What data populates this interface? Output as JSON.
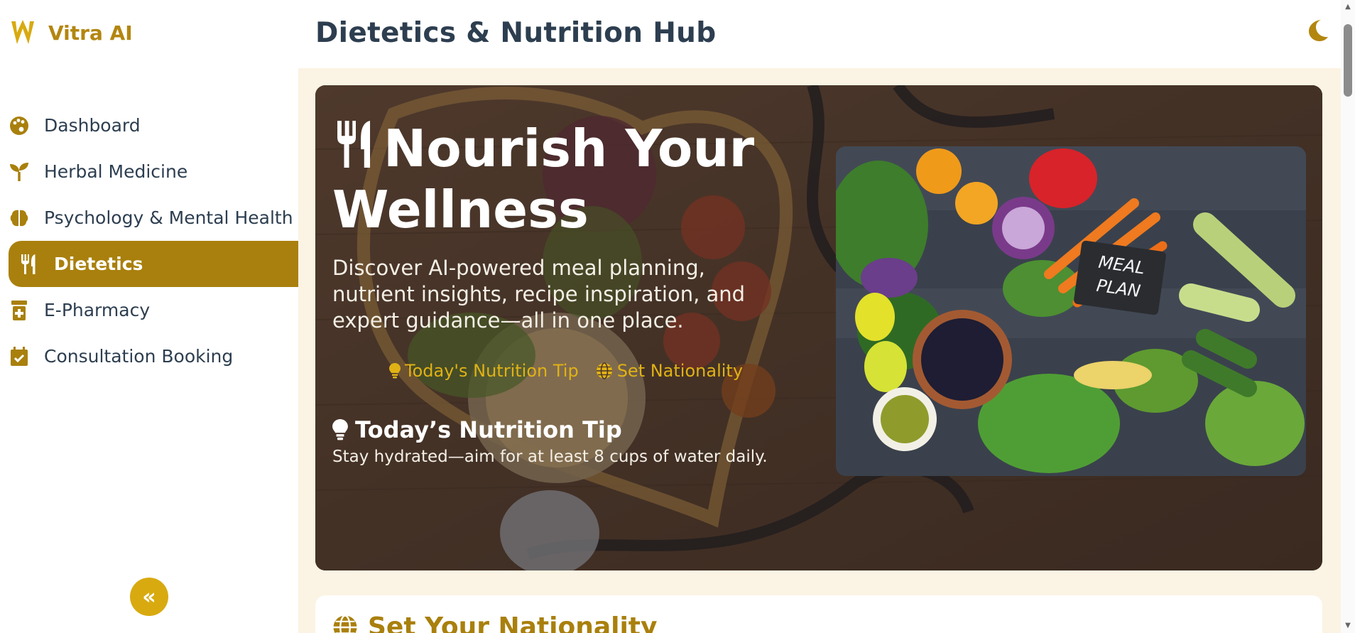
{
  "brand": {
    "name": "Vitra AI"
  },
  "sidebar": {
    "items": [
      {
        "label": "Dashboard",
        "icon": "palette-icon",
        "active": false
      },
      {
        "label": "Herbal Medicine",
        "icon": "seedling-icon",
        "active": false
      },
      {
        "label": "Psychology & Mental Health",
        "icon": "brain-icon",
        "active": false
      },
      {
        "label": "Dietetics",
        "icon": "utensils-icon",
        "active": true
      },
      {
        "label": "E-Pharmacy",
        "icon": "prescription-bottle-icon",
        "active": false
      },
      {
        "label": "Consultation Booking",
        "icon": "calendar-check-icon",
        "active": false
      }
    ],
    "collapse_glyph": "«"
  },
  "header": {
    "title": "Dietetics & Nutrition Hub"
  },
  "hero": {
    "heading": "Nourish Your Wellness",
    "description": "Discover AI-powered meal planning, nutrient insights, recipe inspiration, and expert guidance—all in one place.",
    "links": {
      "tip": "Today's Nutrition Tip",
      "nationality": "Set Nationality"
    },
    "tip_title": "Today’s Nutrition Tip",
    "tip_body": "Stay hydrated—aim for at least 8 cups of water daily.",
    "image_sign_text": "MEAL PLAN"
  },
  "next_section": {
    "title": "Set Your Nationality"
  },
  "colors": {
    "accent": "#a9800d",
    "accent_light": "#e0b215",
    "text": "#2d3e50",
    "page_bg": "#fbf3e3"
  }
}
